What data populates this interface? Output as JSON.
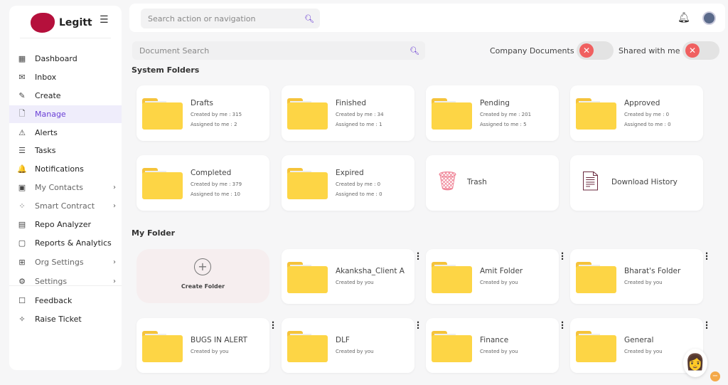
{
  "brand": {
    "name": "Legitt",
    "logo_text": "Legitt"
  },
  "sidebar": {
    "items": [
      {
        "label": "Dashboard",
        "icon": "dashboard-icon",
        "glyph": "▦"
      },
      {
        "label": "Inbox",
        "icon": "inbox-icon",
        "glyph": "✉"
      },
      {
        "label": "Create",
        "icon": "create-icon",
        "glyph": "✎"
      },
      {
        "label": "Manage",
        "icon": "manage-icon",
        "glyph": "🗋",
        "active": true
      },
      {
        "label": "Alerts",
        "icon": "alerts-icon",
        "glyph": "⚠"
      },
      {
        "label": "Tasks",
        "icon": "tasks-icon",
        "glyph": "☰"
      },
      {
        "label": "Notifications",
        "icon": "bell-icon",
        "glyph": "🔔"
      },
      {
        "label": "My Contacts",
        "icon": "contacts-icon",
        "glyph": "▣",
        "chevron": true
      },
      {
        "label": "Smart Contract",
        "icon": "smart-contract-icon",
        "glyph": "⁘",
        "chevron": true
      },
      {
        "label": "Repo Analyzer",
        "icon": "repo-analyzer-icon",
        "glyph": "▤"
      },
      {
        "label": "Reports & Analytics",
        "icon": "reports-icon",
        "glyph": "▢"
      },
      {
        "label": "Org Settings",
        "icon": "org-settings-icon",
        "glyph": "⊞",
        "chevron": true
      },
      {
        "label": "Settings",
        "icon": "gear-icon",
        "glyph": "⚙",
        "chevron": true
      },
      {
        "label": "Feedback",
        "icon": "feedback-icon",
        "glyph": "☐"
      },
      {
        "label": "Raise Ticket",
        "icon": "ticket-icon",
        "glyph": "✧"
      }
    ]
  },
  "header": {
    "search_placeholder": "Search action or navigation"
  },
  "filters": {
    "doc_search_placeholder": "Document Search",
    "company_documents": "Company Documents",
    "company_documents_on": false,
    "shared_with_me": "Shared with me",
    "shared_with_me_on": false
  },
  "system_folders": {
    "title": "System Folders",
    "items": [
      {
        "name": "Drafts",
        "created": "Created by me : 315",
        "assigned": "Assigned to me : 2"
      },
      {
        "name": "Finished",
        "created": "Created by me : 34",
        "assigned": "Assigned to me : 1"
      },
      {
        "name": "Pending",
        "created": "Created by me : 201",
        "assigned": "Assigned to me : 5"
      },
      {
        "name": "Approved",
        "created": "Created by me : 0",
        "assigned": "Assigned to me : 0"
      },
      {
        "name": "Completed",
        "created": "Created by me : 379",
        "assigned": "Assigned to me : 10"
      },
      {
        "name": "Expired",
        "created": "Created by me : 0",
        "assigned": "Assigned to me : 0"
      },
      {
        "name": "Trash",
        "icon": "trash-icon"
      },
      {
        "name": "Download History",
        "icon": "download-history-icon"
      }
    ]
  },
  "my_folder": {
    "title": "My Folder",
    "create_label": "Create Folder",
    "items": [
      {
        "name": "Akanksha_Client A",
        "sub": "Created by you"
      },
      {
        "name": "Amit Folder",
        "sub": "Created by you"
      },
      {
        "name": "Bharat's Folder",
        "sub": "Created by you"
      },
      {
        "name": "BUGS IN ALERT",
        "sub": "Created by you"
      },
      {
        "name": "DLF",
        "sub": "Created by you"
      },
      {
        "name": "Finance",
        "sub": "Created by you"
      },
      {
        "name": "General",
        "sub": "Created by you"
      }
    ]
  },
  "colors": {
    "accent": "#6a3fd6",
    "folder": "#fdd545",
    "brand": "#b5103c",
    "toggle_off": "#f06060"
  }
}
